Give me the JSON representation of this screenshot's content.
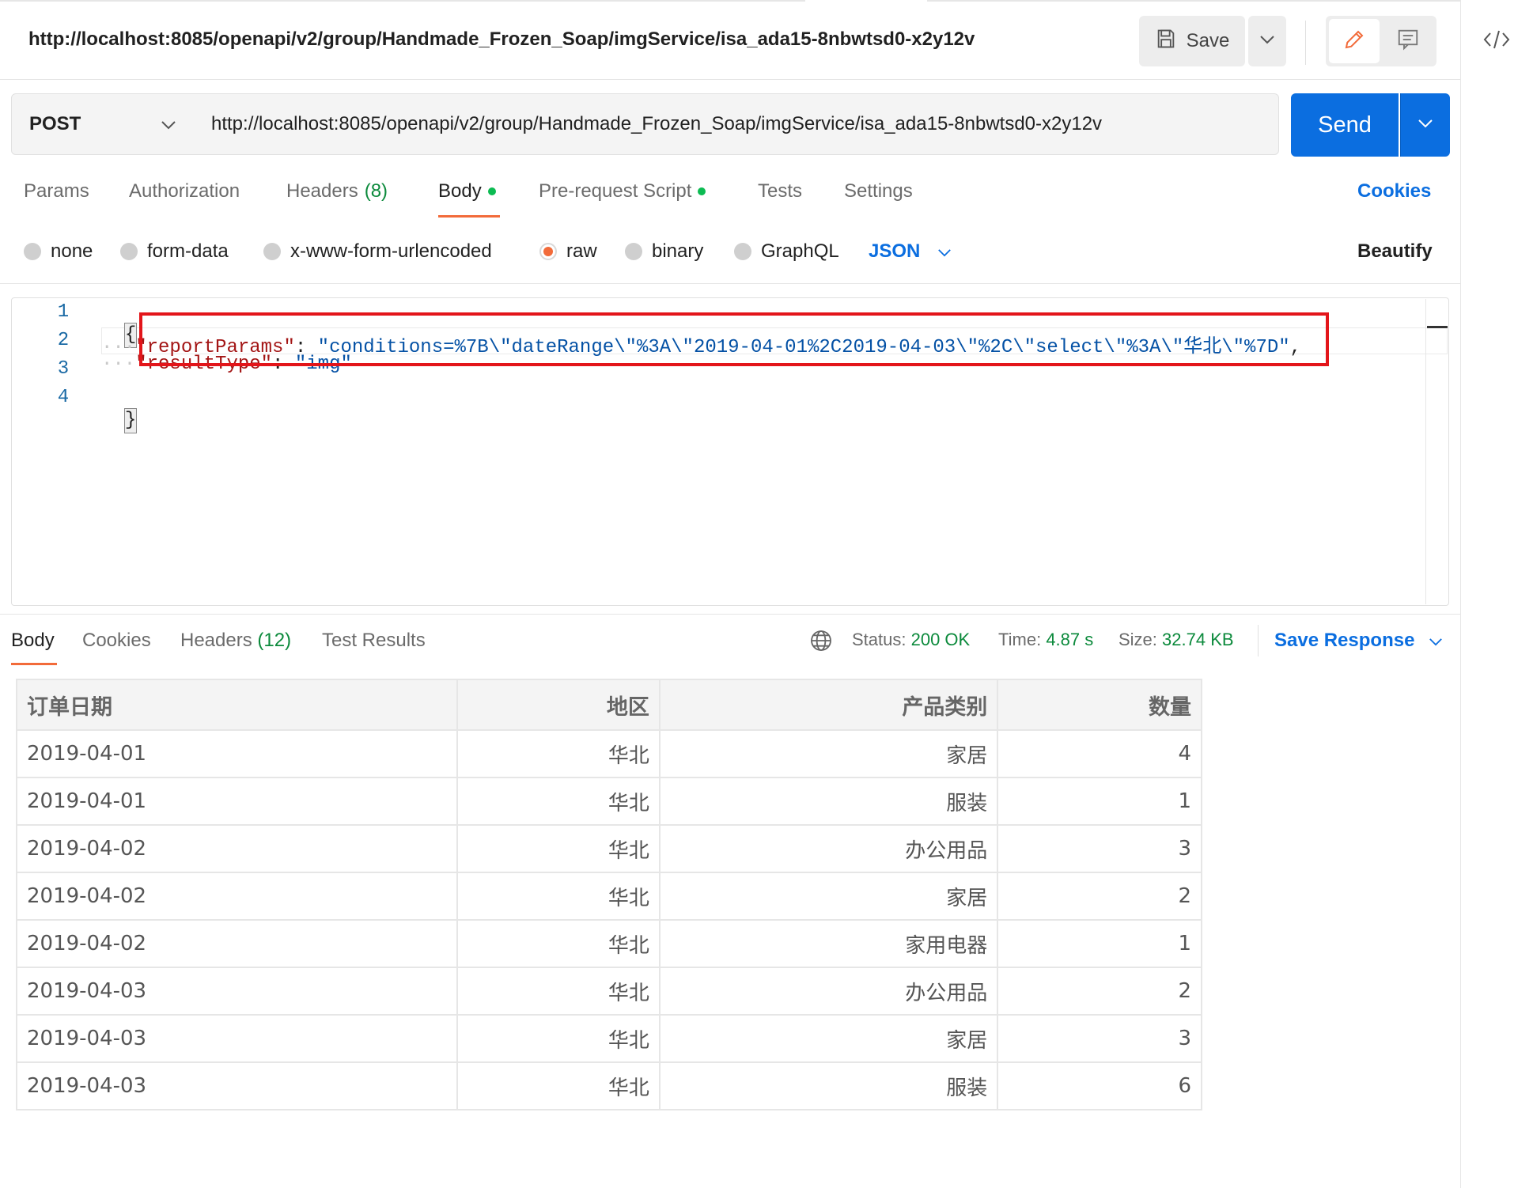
{
  "request": {
    "title": "http://localhost:8085/openapi/v2/group/Handmade_Frozen_Soap/imgService/isa_ada15-8nbwtsd0-x2y12v",
    "method": "POST",
    "url": "http://localhost:8085/openapi/v2/group/Handmade_Frozen_Soap/imgService/isa_ada15-8nbwtsd0-x2y12v",
    "save_label": "Save",
    "send_label": "Send"
  },
  "request_tabs": {
    "params": "Params",
    "authorization": "Authorization",
    "headers": "Headers",
    "headers_count": "(8)",
    "body": "Body",
    "pre_request": "Pre-request Script",
    "tests": "Tests",
    "settings": "Settings",
    "cookies": "Cookies",
    "active": "Body"
  },
  "body_types": {
    "none": "none",
    "form_data": "form-data",
    "urlencoded": "x-www-form-urlencoded",
    "raw": "raw",
    "binary": "binary",
    "graphql": "GraphQL",
    "format": "JSON",
    "beautify": "Beautify",
    "selected": "raw"
  },
  "editor": {
    "line_numbers": [
      "1",
      "2",
      "3",
      "4"
    ],
    "open_brace": "{",
    "close_brace": "}",
    "line2_key": "\"reportParams\"",
    "line2_colon": ": ",
    "line2_value": "\"conditions=%7B\\\"dateRange\\\"%3A\\\"2019-04-01%2C2019-04-03\\\"%2C\\\"select\\\"%3A\\\"华北\\\"%7D\"",
    "line2_comma": ",",
    "line3_key": "\"resultType\"",
    "line3_colon": ": ",
    "line3_value": "\"img\""
  },
  "response_tabs": {
    "body": "Body",
    "cookies": "Cookies",
    "headers": "Headers",
    "headers_count": "(12)",
    "test_results": "Test Results"
  },
  "response_status": {
    "status_label": "Status:",
    "status_value": "200 OK",
    "time_label": "Time:",
    "time_value": "4.87 s",
    "size_label": "Size:",
    "size_value": "32.74 KB",
    "save_response": "Save Response"
  },
  "table": {
    "headers": [
      "订单日期",
      "地区",
      "产品类别",
      "数量"
    ],
    "rows": [
      [
        "2019-04-01",
        "华北",
        "家居",
        "4"
      ],
      [
        "2019-04-01",
        "华北",
        "服装",
        "1"
      ],
      [
        "2019-04-02",
        "华北",
        "办公用品",
        "3"
      ],
      [
        "2019-04-02",
        "华北",
        "家居",
        "2"
      ],
      [
        "2019-04-02",
        "华北",
        "家用电器",
        "1"
      ],
      [
        "2019-04-03",
        "华北",
        "办公用品",
        "2"
      ],
      [
        "2019-04-03",
        "华北",
        "家居",
        "3"
      ],
      [
        "2019-04-03",
        "华北",
        "服装",
        "6"
      ]
    ]
  },
  "colors": {
    "accent": "#f26b3a",
    "brand_blue": "#0b6ee0",
    "highlight_red": "#e3151a",
    "success_green": "#0c8a3c"
  },
  "icons": {
    "save": "floppy-disk-icon",
    "edit": "pencil-icon",
    "comment": "comment-icon",
    "code": "code-icon",
    "globe": "globe-icon"
  }
}
